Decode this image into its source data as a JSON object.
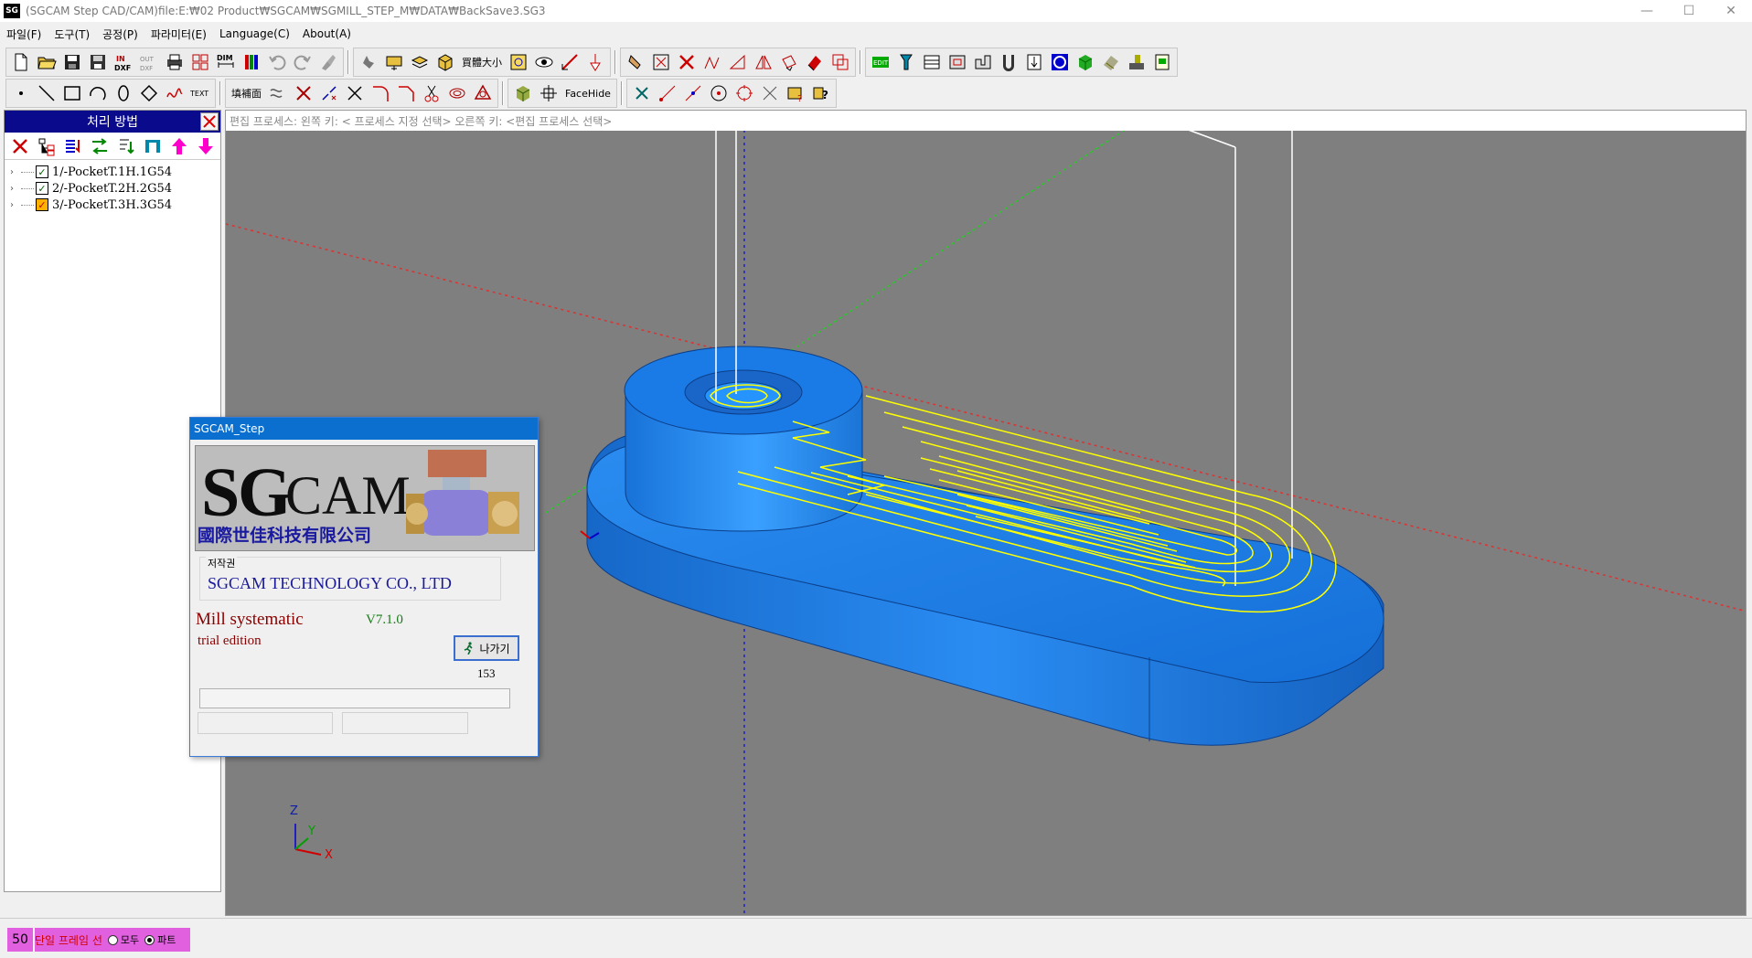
{
  "window": {
    "title": "(SGCAM Step CAD/CAM)file:E:₩02 Product₩SGCAM₩SGMILL_STEP_M₩DATA₩BackSave3.SG3",
    "logo": "SG",
    "min": "—",
    "max": "☐",
    "close": "✕"
  },
  "menu": [
    "파일(F)",
    "도구(T)",
    "공정(P)",
    "파라미터(E)",
    "Language(C)",
    "About(A)"
  ],
  "toolbar": {
    "in_dxf": "IN\nDXF",
    "out_dxf": "OUT\nDXF",
    "dim": "DIM",
    "size_label": "買體大小",
    "fill_label": "填補面",
    "text_label": "TEXT",
    "facehide_label": "FaceHide"
  },
  "left_panel": {
    "title": "처리 방법",
    "items": [
      {
        "label": "1/-PocketT.1H.1G54",
        "checked": true
      },
      {
        "label": "2/-PocketT.2H.2G54",
        "checked": true
      },
      {
        "label": "3/-PocketT.3H.3G54",
        "checked": true
      }
    ]
  },
  "viewport": {
    "status": "편집 프로세스: 왼쪽 키: < 프로세스 지정 선택> 오른쪽 키: <편집 프로세스 선택>",
    "axes": {
      "z": "Z",
      "y": "Y",
      "x": "X"
    },
    "colors": {
      "background": "#7f7f7f",
      "part": "#1f7fe8",
      "toolpath": "#ffff00",
      "tool_line": "#ffffff"
    }
  },
  "dialog": {
    "title": "SGCAM_Step",
    "brand": "SGCAM",
    "brand_s": "S",
    "brand_g": "G",
    "brand_cam": "CAM",
    "registered": "®",
    "company_cn": "國際世佳科技有限公司",
    "copyright_label": "저작권",
    "copyright_value": "SGCAM TECHNOLOGY CO., LTD",
    "product": "Mill systematic",
    "version": "V7.1.0",
    "edition": "trial edition",
    "exit_label": "나가기",
    "counter": "153"
  },
  "bottom": {
    "frame_count": "50",
    "frame_label": "단일 프레임 선",
    "radio_all": "모두",
    "radio_part": "파트",
    "selected": "파트"
  }
}
